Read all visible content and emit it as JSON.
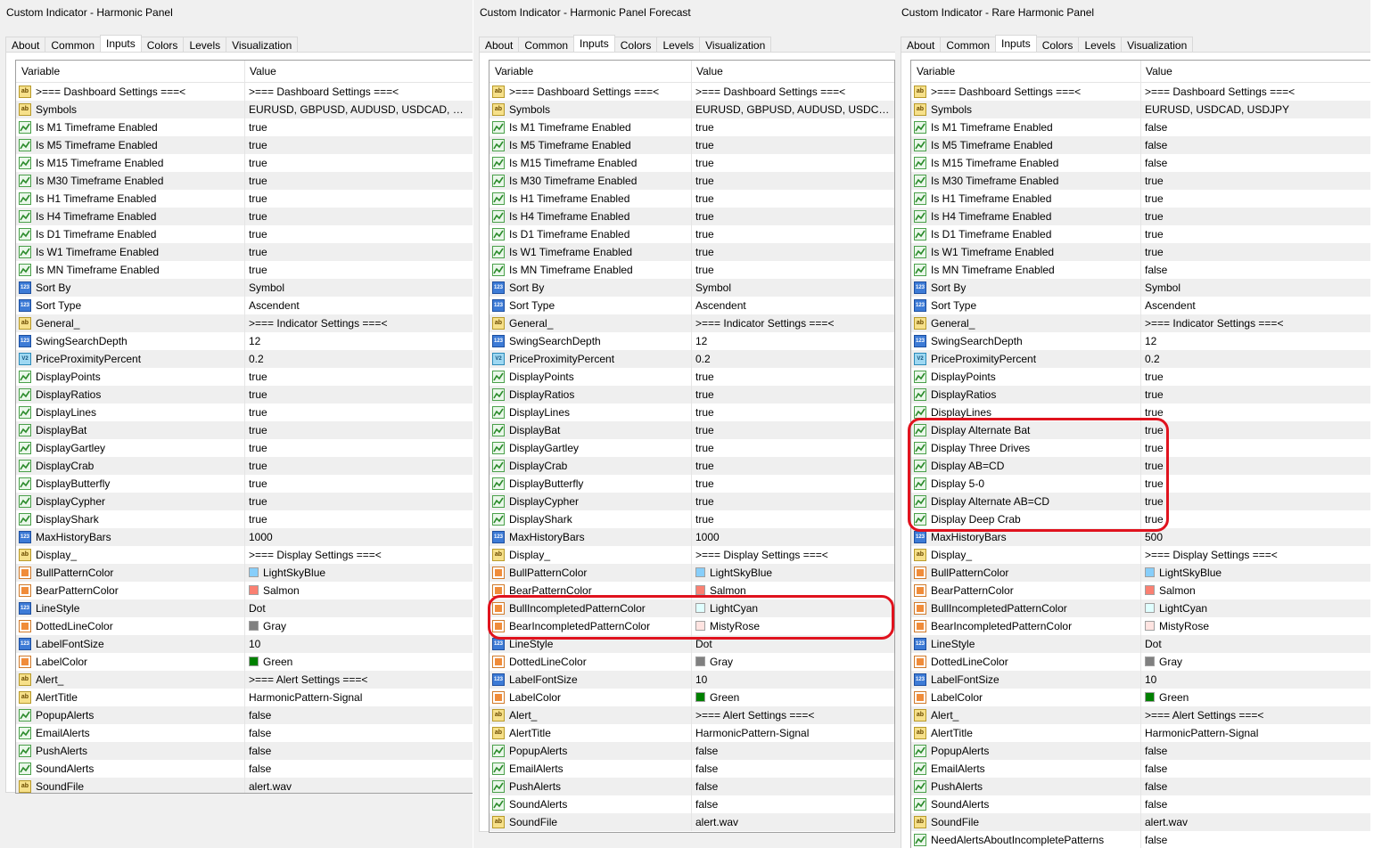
{
  "header": {
    "variable": "Variable",
    "value": "Value"
  },
  "tabs": [
    "About",
    "Common",
    "Inputs",
    "Colors",
    "Levels",
    "Visualization"
  ],
  "panels": [
    {
      "title": "Custom Indicator - Harmonic Panel",
      "rows": [
        {
          "icon": "string",
          "name": ">=== Dashboard Settings ===<",
          "value": ">=== Dashboard Settings ===<"
        },
        {
          "icon": "string",
          "name": "Symbols",
          "value": "EURUSD, GBPUSD, AUDUSD, USDCAD, USDC..."
        },
        {
          "icon": "bool",
          "name": "Is M1 Timeframe Enabled",
          "value": "true"
        },
        {
          "icon": "bool",
          "name": "Is M5 Timeframe Enabled",
          "value": "true"
        },
        {
          "icon": "bool",
          "name": "Is M15 Timeframe Enabled",
          "value": "true"
        },
        {
          "icon": "bool",
          "name": "Is M30 Timeframe Enabled",
          "value": "true"
        },
        {
          "icon": "bool",
          "name": "Is H1 Timeframe Enabled",
          "value": "true"
        },
        {
          "icon": "bool",
          "name": "Is H4 Timeframe Enabled",
          "value": "true"
        },
        {
          "icon": "bool",
          "name": "Is D1 Timeframe Enabled",
          "value": "true"
        },
        {
          "icon": "bool",
          "name": "Is W1 Timeframe Enabled",
          "value": "true"
        },
        {
          "icon": "bool",
          "name": "Is MN Timeframe Enabled",
          "value": "true"
        },
        {
          "icon": "int",
          "name": "Sort By",
          "value": "Symbol"
        },
        {
          "icon": "int",
          "name": "Sort Type",
          "value": "Ascendent"
        },
        {
          "icon": "string",
          "name": "General_",
          "value": ">=== Indicator Settings ===<"
        },
        {
          "icon": "int",
          "name": "SwingSearchDepth",
          "value": "12"
        },
        {
          "icon": "double",
          "name": "PriceProximityPercent",
          "value": "0.2"
        },
        {
          "icon": "bool",
          "name": "DisplayPoints",
          "value": "true"
        },
        {
          "icon": "bool",
          "name": "DisplayRatios",
          "value": "true"
        },
        {
          "icon": "bool",
          "name": "DisplayLines",
          "value": "true"
        },
        {
          "icon": "bool",
          "name": "DisplayBat",
          "value": "true"
        },
        {
          "icon": "bool",
          "name": "DisplayGartley",
          "value": "true"
        },
        {
          "icon": "bool",
          "name": "DisplayCrab",
          "value": "true"
        },
        {
          "icon": "bool",
          "name": "DisplayButterfly",
          "value": "true"
        },
        {
          "icon": "bool",
          "name": "DisplayCypher",
          "value": "true"
        },
        {
          "icon": "bool",
          "name": "DisplayShark",
          "value": "true"
        },
        {
          "icon": "int",
          "name": "MaxHistoryBars",
          "value": "1000"
        },
        {
          "icon": "string",
          "name": "Display_",
          "value": ">=== Display Settings ===<"
        },
        {
          "icon": "color",
          "name": "BullPatternColor",
          "value": "LightSkyBlue",
          "swatch": "#87cefa"
        },
        {
          "icon": "color",
          "name": "BearPatternColor",
          "value": "Salmon",
          "swatch": "#fa8072"
        },
        {
          "icon": "int",
          "name": "LineStyle",
          "value": "Dot"
        },
        {
          "icon": "color",
          "name": "DottedLineColor",
          "value": "Gray",
          "swatch": "#808080"
        },
        {
          "icon": "int",
          "name": "LabelFontSize",
          "value": "10"
        },
        {
          "icon": "color",
          "name": "LabelColor",
          "value": "Green",
          "swatch": "#008000"
        },
        {
          "icon": "string",
          "name": "Alert_",
          "value": ">=== Alert Settings ===<"
        },
        {
          "icon": "string",
          "name": "AlertTitle",
          "value": "HarmonicPattern-Signal"
        },
        {
          "icon": "bool",
          "name": "PopupAlerts",
          "value": "false"
        },
        {
          "icon": "bool",
          "name": "EmailAlerts",
          "value": "false"
        },
        {
          "icon": "bool",
          "name": "PushAlerts",
          "value": "false"
        },
        {
          "icon": "bool",
          "name": "SoundAlerts",
          "value": "false"
        },
        {
          "icon": "string",
          "name": "SoundFile",
          "value": "alert.wav"
        }
      ]
    },
    {
      "title": "Custom Indicator - Harmonic Panel Forecast",
      "rows": [
        {
          "icon": "string",
          "name": ">=== Dashboard Settings ===<",
          "value": ">=== Dashboard Settings ===<"
        },
        {
          "icon": "string",
          "name": "Symbols",
          "value": "EURUSD, GBPUSD, AUDUSD, USDCAD, ..."
        },
        {
          "icon": "bool",
          "name": "Is M1 Timeframe Enabled",
          "value": "true"
        },
        {
          "icon": "bool",
          "name": "Is M5 Timeframe Enabled",
          "value": "true"
        },
        {
          "icon": "bool",
          "name": "Is M15 Timeframe Enabled",
          "value": "true"
        },
        {
          "icon": "bool",
          "name": "Is M30 Timeframe Enabled",
          "value": "true"
        },
        {
          "icon": "bool",
          "name": "Is H1 Timeframe Enabled",
          "value": "true"
        },
        {
          "icon": "bool",
          "name": "Is H4 Timeframe Enabled",
          "value": "true"
        },
        {
          "icon": "bool",
          "name": "Is D1 Timeframe Enabled",
          "value": "true"
        },
        {
          "icon": "bool",
          "name": "Is W1 Timeframe Enabled",
          "value": "true"
        },
        {
          "icon": "bool",
          "name": "Is MN Timeframe Enabled",
          "value": "true"
        },
        {
          "icon": "int",
          "name": "Sort By",
          "value": "Symbol"
        },
        {
          "icon": "int",
          "name": "Sort Type",
          "value": "Ascendent"
        },
        {
          "icon": "string",
          "name": "General_",
          "value": ">=== Indicator Settings ===<"
        },
        {
          "icon": "int",
          "name": "SwingSearchDepth",
          "value": "12"
        },
        {
          "icon": "double",
          "name": "PriceProximityPercent",
          "value": "0.2"
        },
        {
          "icon": "bool",
          "name": "DisplayPoints",
          "value": "true"
        },
        {
          "icon": "bool",
          "name": "DisplayRatios",
          "value": "true"
        },
        {
          "icon": "bool",
          "name": "DisplayLines",
          "value": "true"
        },
        {
          "icon": "bool",
          "name": "DisplayBat",
          "value": "true"
        },
        {
          "icon": "bool",
          "name": "DisplayGartley",
          "value": "true"
        },
        {
          "icon": "bool",
          "name": "DisplayCrab",
          "value": "true"
        },
        {
          "icon": "bool",
          "name": "DisplayButterfly",
          "value": "true"
        },
        {
          "icon": "bool",
          "name": "DisplayCypher",
          "value": "true"
        },
        {
          "icon": "bool",
          "name": "DisplayShark",
          "value": "true"
        },
        {
          "icon": "int",
          "name": "MaxHistoryBars",
          "value": "1000"
        },
        {
          "icon": "string",
          "name": "Display_",
          "value": ">=== Display Settings ===<"
        },
        {
          "icon": "color",
          "name": "BullPatternColor",
          "value": "LightSkyBlue",
          "swatch": "#87cefa"
        },
        {
          "icon": "color",
          "name": "BearPatternColor",
          "value": "Salmon",
          "swatch": "#fa8072"
        },
        {
          "icon": "color",
          "name": "BullIncompletedPatternColor",
          "value": "LightCyan",
          "swatch": "#e0ffff"
        },
        {
          "icon": "color",
          "name": "BearIncompletedPatternColor",
          "value": "MistyRose",
          "swatch": "#ffe4e1"
        },
        {
          "icon": "int",
          "name": "LineStyle",
          "value": "Dot"
        },
        {
          "icon": "color",
          "name": "DottedLineColor",
          "value": "Gray",
          "swatch": "#808080"
        },
        {
          "icon": "int",
          "name": "LabelFontSize",
          "value": "10"
        },
        {
          "icon": "color",
          "name": "LabelColor",
          "value": "Green",
          "swatch": "#008000"
        },
        {
          "icon": "string",
          "name": "Alert_",
          "value": ">=== Alert Settings ===<"
        },
        {
          "icon": "string",
          "name": "AlertTitle",
          "value": "HarmonicPattern-Signal"
        },
        {
          "icon": "bool",
          "name": "PopupAlerts",
          "value": "false"
        },
        {
          "icon": "bool",
          "name": "EmailAlerts",
          "value": "false"
        },
        {
          "icon": "bool",
          "name": "PushAlerts",
          "value": "false"
        },
        {
          "icon": "bool",
          "name": "SoundAlerts",
          "value": "false"
        },
        {
          "icon": "string",
          "name": "SoundFile",
          "value": "alert.wav"
        }
      ]
    },
    {
      "title": "Custom Indicator - Rare Harmonic Panel",
      "rows": [
        {
          "icon": "string",
          "name": ">=== Dashboard Settings ===<",
          "value": ">=== Dashboard Settings ===<"
        },
        {
          "icon": "string",
          "name": "Symbols",
          "value": "EURUSD, USDCAD, USDJPY"
        },
        {
          "icon": "bool",
          "name": "Is M1 Timeframe Enabled",
          "value": "false"
        },
        {
          "icon": "bool",
          "name": "Is M5 Timeframe Enabled",
          "value": "false"
        },
        {
          "icon": "bool",
          "name": "Is M15 Timeframe Enabled",
          "value": "false"
        },
        {
          "icon": "bool",
          "name": "Is M30 Timeframe Enabled",
          "value": "true"
        },
        {
          "icon": "bool",
          "name": "Is H1 Timeframe Enabled",
          "value": "true"
        },
        {
          "icon": "bool",
          "name": "Is H4 Timeframe Enabled",
          "value": "true"
        },
        {
          "icon": "bool",
          "name": "Is D1 Timeframe Enabled",
          "value": "true"
        },
        {
          "icon": "bool",
          "name": "Is W1 Timeframe Enabled",
          "value": "true"
        },
        {
          "icon": "bool",
          "name": "Is MN Timeframe Enabled",
          "value": "false"
        },
        {
          "icon": "int",
          "name": "Sort By",
          "value": "Symbol"
        },
        {
          "icon": "int",
          "name": "Sort Type",
          "value": "Ascendent"
        },
        {
          "icon": "string",
          "name": "General_",
          "value": ">=== Indicator Settings ===<"
        },
        {
          "icon": "int",
          "name": "SwingSearchDepth",
          "value": "12"
        },
        {
          "icon": "double",
          "name": "PriceProximityPercent",
          "value": "0.2"
        },
        {
          "icon": "bool",
          "name": "DisplayPoints",
          "value": "true"
        },
        {
          "icon": "bool",
          "name": "DisplayRatios",
          "value": "true"
        },
        {
          "icon": "bool",
          "name": "DisplayLines",
          "value": "true"
        },
        {
          "icon": "bool",
          "name": "Display Alternate Bat",
          "value": "true"
        },
        {
          "icon": "bool",
          "name": "Display Three Drives",
          "value": "true"
        },
        {
          "icon": "bool",
          "name": "Display AB=CD",
          "value": "true"
        },
        {
          "icon": "bool",
          "name": "Display 5-0",
          "value": "true"
        },
        {
          "icon": "bool",
          "name": "Display Alternate AB=CD",
          "value": "true"
        },
        {
          "icon": "bool",
          "name": "Display Deep Crab",
          "value": "true"
        },
        {
          "icon": "int",
          "name": "MaxHistoryBars",
          "value": "500"
        },
        {
          "icon": "string",
          "name": "Display_",
          "value": ">=== Display Settings ===<"
        },
        {
          "icon": "color",
          "name": "BullPatternColor",
          "value": "LightSkyBlue",
          "swatch": "#87cefa"
        },
        {
          "icon": "color",
          "name": "BearPatternColor",
          "value": "Salmon",
          "swatch": "#fa8072"
        },
        {
          "icon": "color",
          "name": "BullIncompletedPatternColor",
          "value": "LightCyan",
          "swatch": "#e0ffff"
        },
        {
          "icon": "color",
          "name": "BearIncompletedPatternColor",
          "value": "MistyRose",
          "swatch": "#ffe4e1"
        },
        {
          "icon": "int",
          "name": "LineStyle",
          "value": "Dot"
        },
        {
          "icon": "color",
          "name": "DottedLineColor",
          "value": "Gray",
          "swatch": "#808080"
        },
        {
          "icon": "int",
          "name": "LabelFontSize",
          "value": "10"
        },
        {
          "icon": "color",
          "name": "LabelColor",
          "value": "Green",
          "swatch": "#008000"
        },
        {
          "icon": "string",
          "name": "Alert_",
          "value": ">=== Alert Settings ===<"
        },
        {
          "icon": "string",
          "name": "AlertTitle",
          "value": "HarmonicPattern-Signal"
        },
        {
          "icon": "bool",
          "name": "PopupAlerts",
          "value": "false"
        },
        {
          "icon": "bool",
          "name": "EmailAlerts",
          "value": "false"
        },
        {
          "icon": "bool",
          "name": "PushAlerts",
          "value": "false"
        },
        {
          "icon": "bool",
          "name": "SoundAlerts",
          "value": "false"
        },
        {
          "icon": "string",
          "name": "SoundFile",
          "value": "alert.wav"
        },
        {
          "icon": "bool",
          "name": "NeedAlertsAboutIncompletePatterns",
          "value": "false"
        }
      ]
    }
  ],
  "colors": {
    "highlight": "#e0131e",
    "grid_alt_row": "#efefef"
  }
}
